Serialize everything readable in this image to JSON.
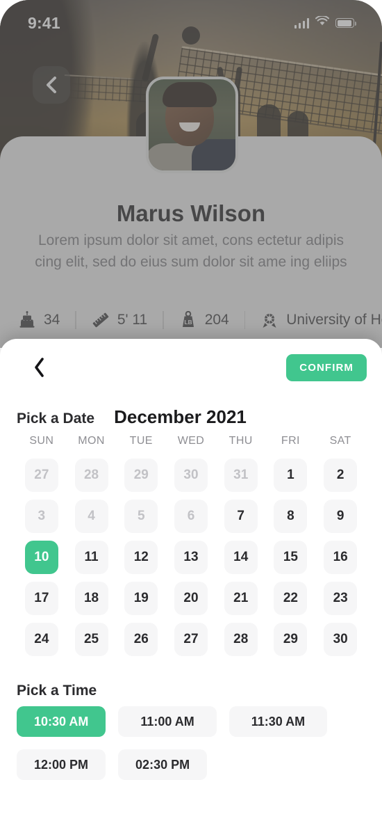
{
  "status_bar": {
    "time": "9:41",
    "icons": [
      "cellular-signal-icon",
      "wifi-icon",
      "battery-icon"
    ]
  },
  "profile": {
    "back_icon": "chevron-left-icon",
    "avatar": "user-avatar-photo",
    "name": "Marus Wilson",
    "bio": "Lorem ipsum dolor sit amet, cons ectetur adipis cing elit, sed do eius sum dolor sit ame ing eliips",
    "stats": [
      {
        "icon": "birthday-cake-icon",
        "value": "34"
      },
      {
        "icon": "ruler-icon",
        "value": "5' 11"
      },
      {
        "icon": "weight-icon",
        "value": "204"
      },
      {
        "icon": "graduation-cap-icon",
        "value": "University of Ho"
      }
    ]
  },
  "sheet": {
    "back_icon": "chevron-left-icon",
    "confirm_label": "CONFIRM",
    "pick_date_label": "Pick a Date",
    "month_label": "December 2021",
    "weekdays": [
      "SUN",
      "MON",
      "TUE",
      "WED",
      "THU",
      "FRI",
      "SAT"
    ],
    "days": [
      {
        "n": "27",
        "state": "muted"
      },
      {
        "n": "28",
        "state": "muted"
      },
      {
        "n": "29",
        "state": "muted"
      },
      {
        "n": "30",
        "state": "muted"
      },
      {
        "n": "31",
        "state": "muted"
      },
      {
        "n": "1",
        "state": "normal"
      },
      {
        "n": "2",
        "state": "normal"
      },
      {
        "n": "3",
        "state": "muted"
      },
      {
        "n": "4",
        "state": "muted"
      },
      {
        "n": "5",
        "state": "muted"
      },
      {
        "n": "6",
        "state": "muted"
      },
      {
        "n": "7",
        "state": "normal"
      },
      {
        "n": "8",
        "state": "normal"
      },
      {
        "n": "9",
        "state": "normal"
      },
      {
        "n": "10",
        "state": "selected"
      },
      {
        "n": "11",
        "state": "normal"
      },
      {
        "n": "12",
        "state": "normal"
      },
      {
        "n": "13",
        "state": "normal"
      },
      {
        "n": "14",
        "state": "normal"
      },
      {
        "n": "15",
        "state": "normal"
      },
      {
        "n": "16",
        "state": "normal"
      },
      {
        "n": "17",
        "state": "normal"
      },
      {
        "n": "18",
        "state": "normal"
      },
      {
        "n": "19",
        "state": "normal"
      },
      {
        "n": "20",
        "state": "normal"
      },
      {
        "n": "21",
        "state": "normal"
      },
      {
        "n": "22",
        "state": "normal"
      },
      {
        "n": "23",
        "state": "normal"
      },
      {
        "n": "24",
        "state": "normal"
      },
      {
        "n": "25",
        "state": "normal"
      },
      {
        "n": "26",
        "state": "normal"
      },
      {
        "n": "27",
        "state": "normal"
      },
      {
        "n": "28",
        "state": "normal"
      },
      {
        "n": "29",
        "state": "normal"
      },
      {
        "n": "30",
        "state": "normal"
      }
    ],
    "pick_time_label": "Pick a Time",
    "times": [
      {
        "label": "10:30 AM",
        "state": "selected",
        "w": "w1"
      },
      {
        "label": "11:00 AM",
        "state": "normal",
        "w": "w2"
      },
      {
        "label": "11:30 AM",
        "state": "normal",
        "w": "w2"
      },
      {
        "label": "12:00 PM",
        "state": "normal",
        "w": "w1"
      },
      {
        "label": "02:30 PM",
        "state": "normal",
        "w": "w1"
      }
    ]
  },
  "colors": {
    "accent": "#41c68e",
    "cell_bg": "#f6f6f7",
    "text": "#2b2b2e",
    "muted": "#c2c2c6",
    "card_bg": "#e9e9e9"
  }
}
